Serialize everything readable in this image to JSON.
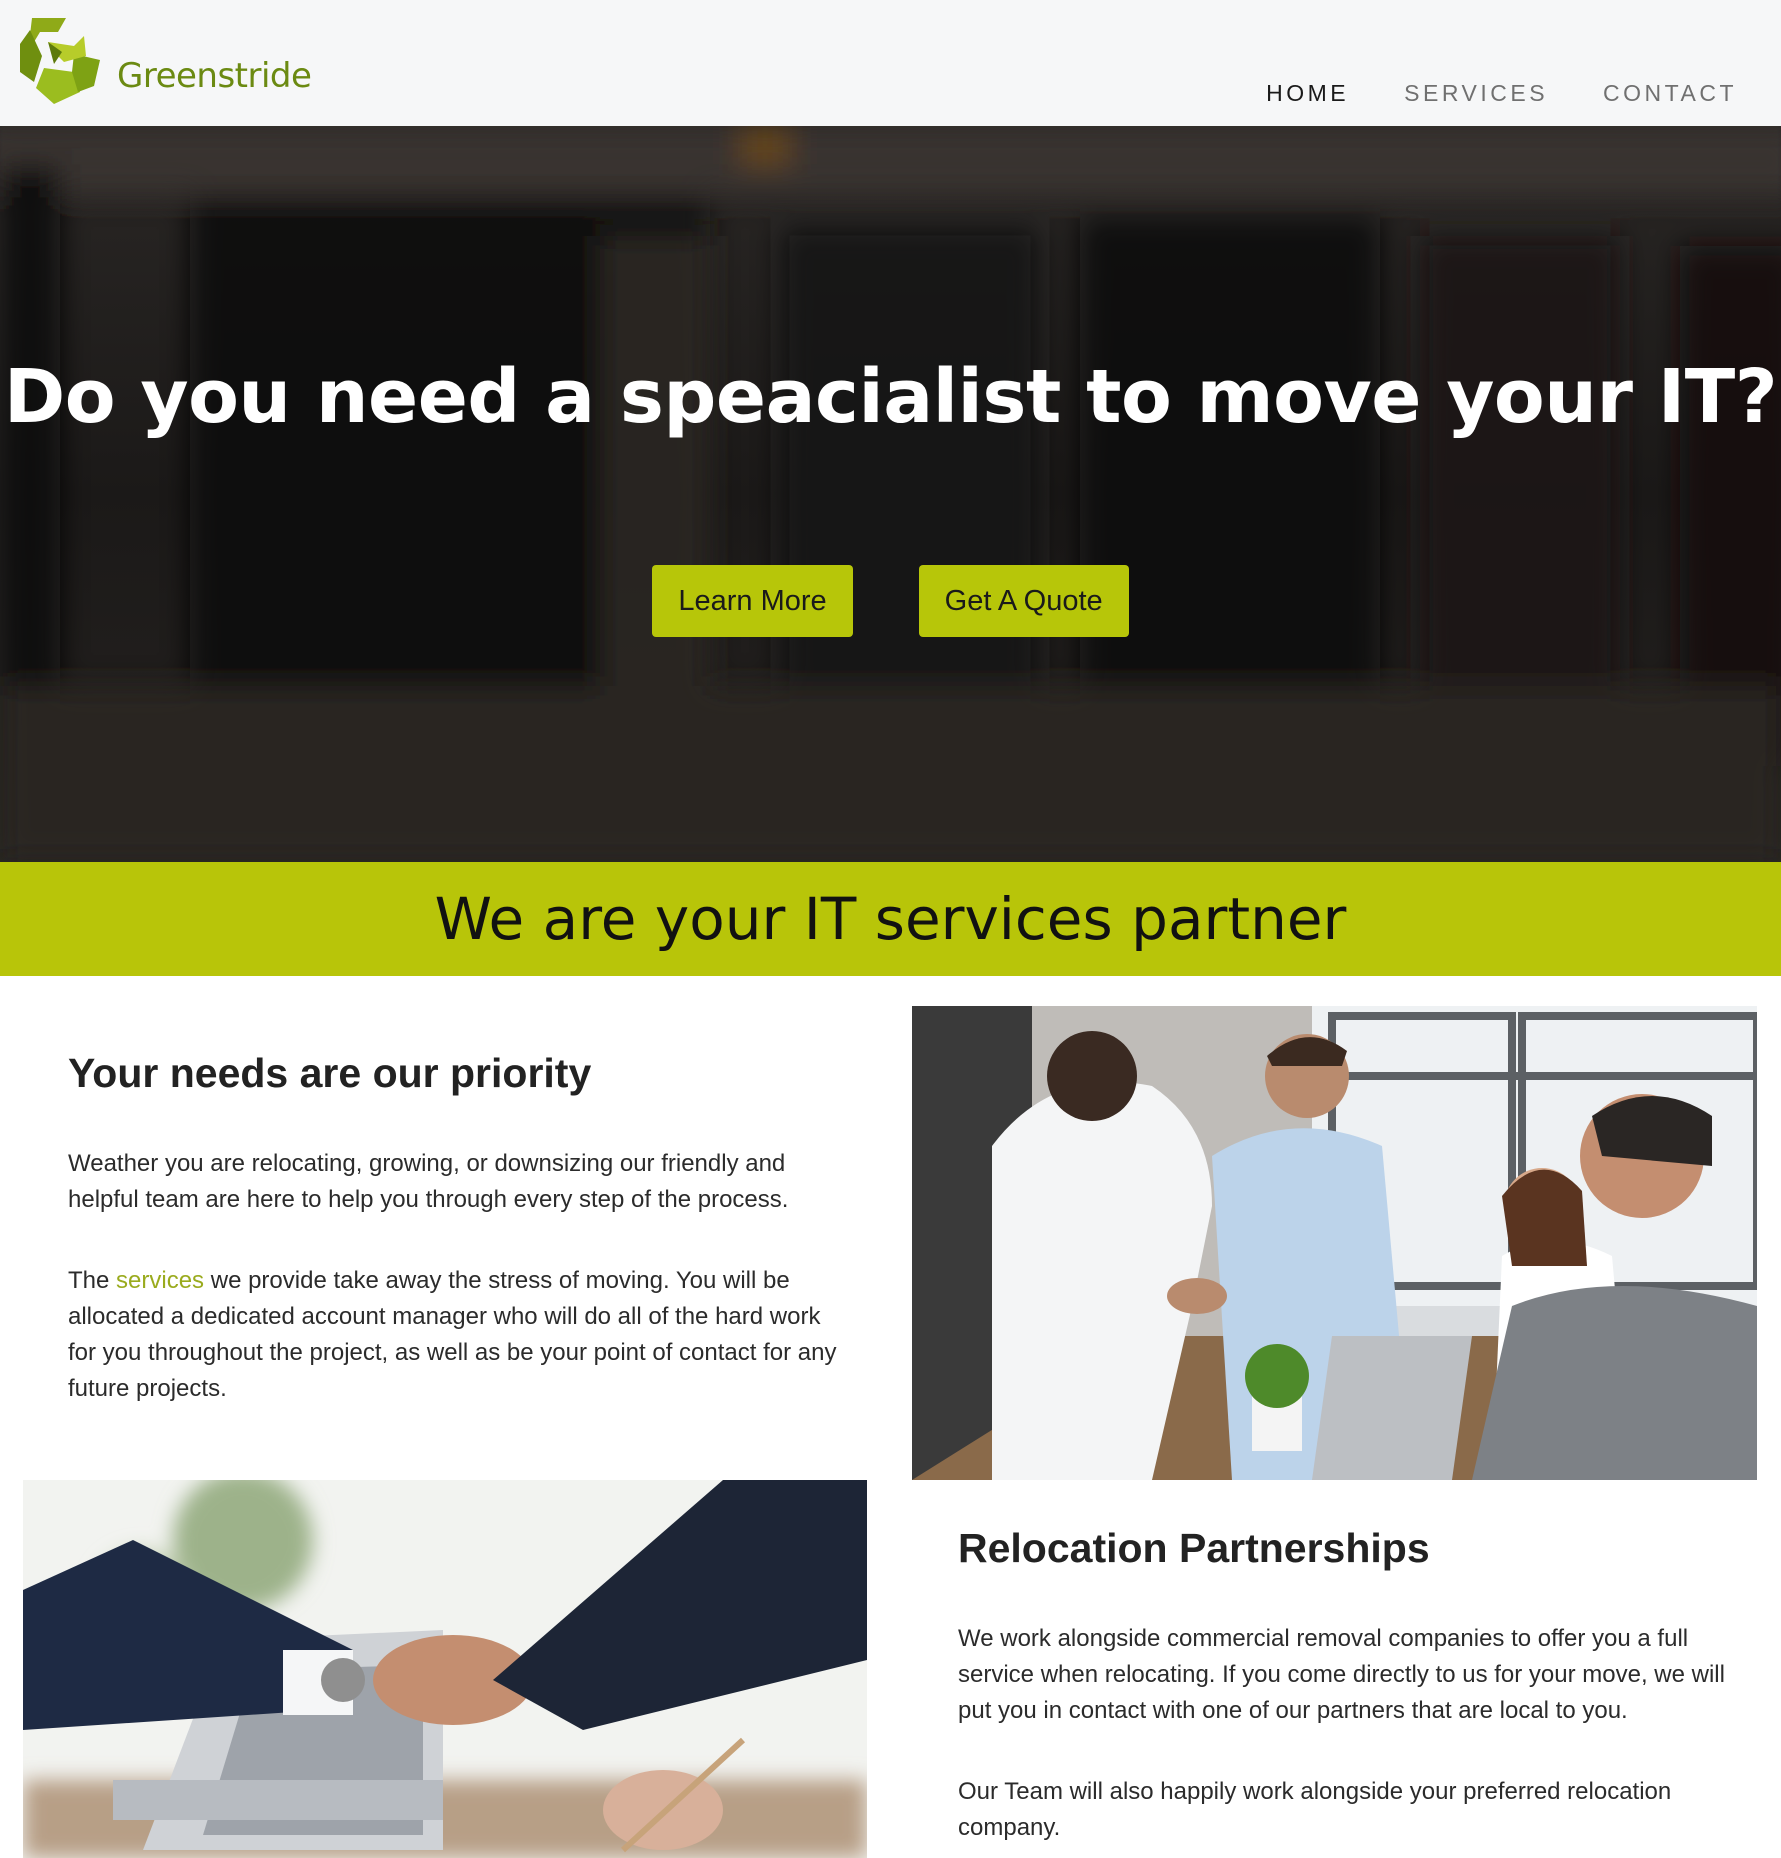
{
  "brand": {
    "name": "Greenstride",
    "logo_icon": "greenstride-logo-icon",
    "color": "#b8c509"
  },
  "nav": {
    "items": [
      {
        "label": "HOME",
        "active": true
      },
      {
        "label": "SERVICES",
        "active": false
      },
      {
        "label": "CONTACT",
        "active": false
      }
    ]
  },
  "hero": {
    "title": "Do you need a speacialist to move your IT?",
    "buttons": {
      "learn_more": "Learn More",
      "get_quote": "Get A Quote"
    }
  },
  "band": {
    "title": "We are your IT services partner"
  },
  "priority": {
    "title": "Your needs are our priority",
    "para1": "Weather you are relocating, growing, or downsizing our friendly and helpful team are here to help you through every step of the process.",
    "para2_before": "The ",
    "para2_link": "services",
    "para2_after": " we provide take away the stress of moving. You will be allocated a dedicated account manager who will do all of the hard work for you throughout the project, as well as be your point of contact for any future projects."
  },
  "relocation": {
    "title": "Relocation Partnerships",
    "para1": "We work alongside commercial removal companies to offer you a full service when relocating. If you come directly to us for your move, we will put you in contact with one of our partners that are local to you.",
    "para2": "Our Team will also happily work alongside your preferred relocation company."
  }
}
